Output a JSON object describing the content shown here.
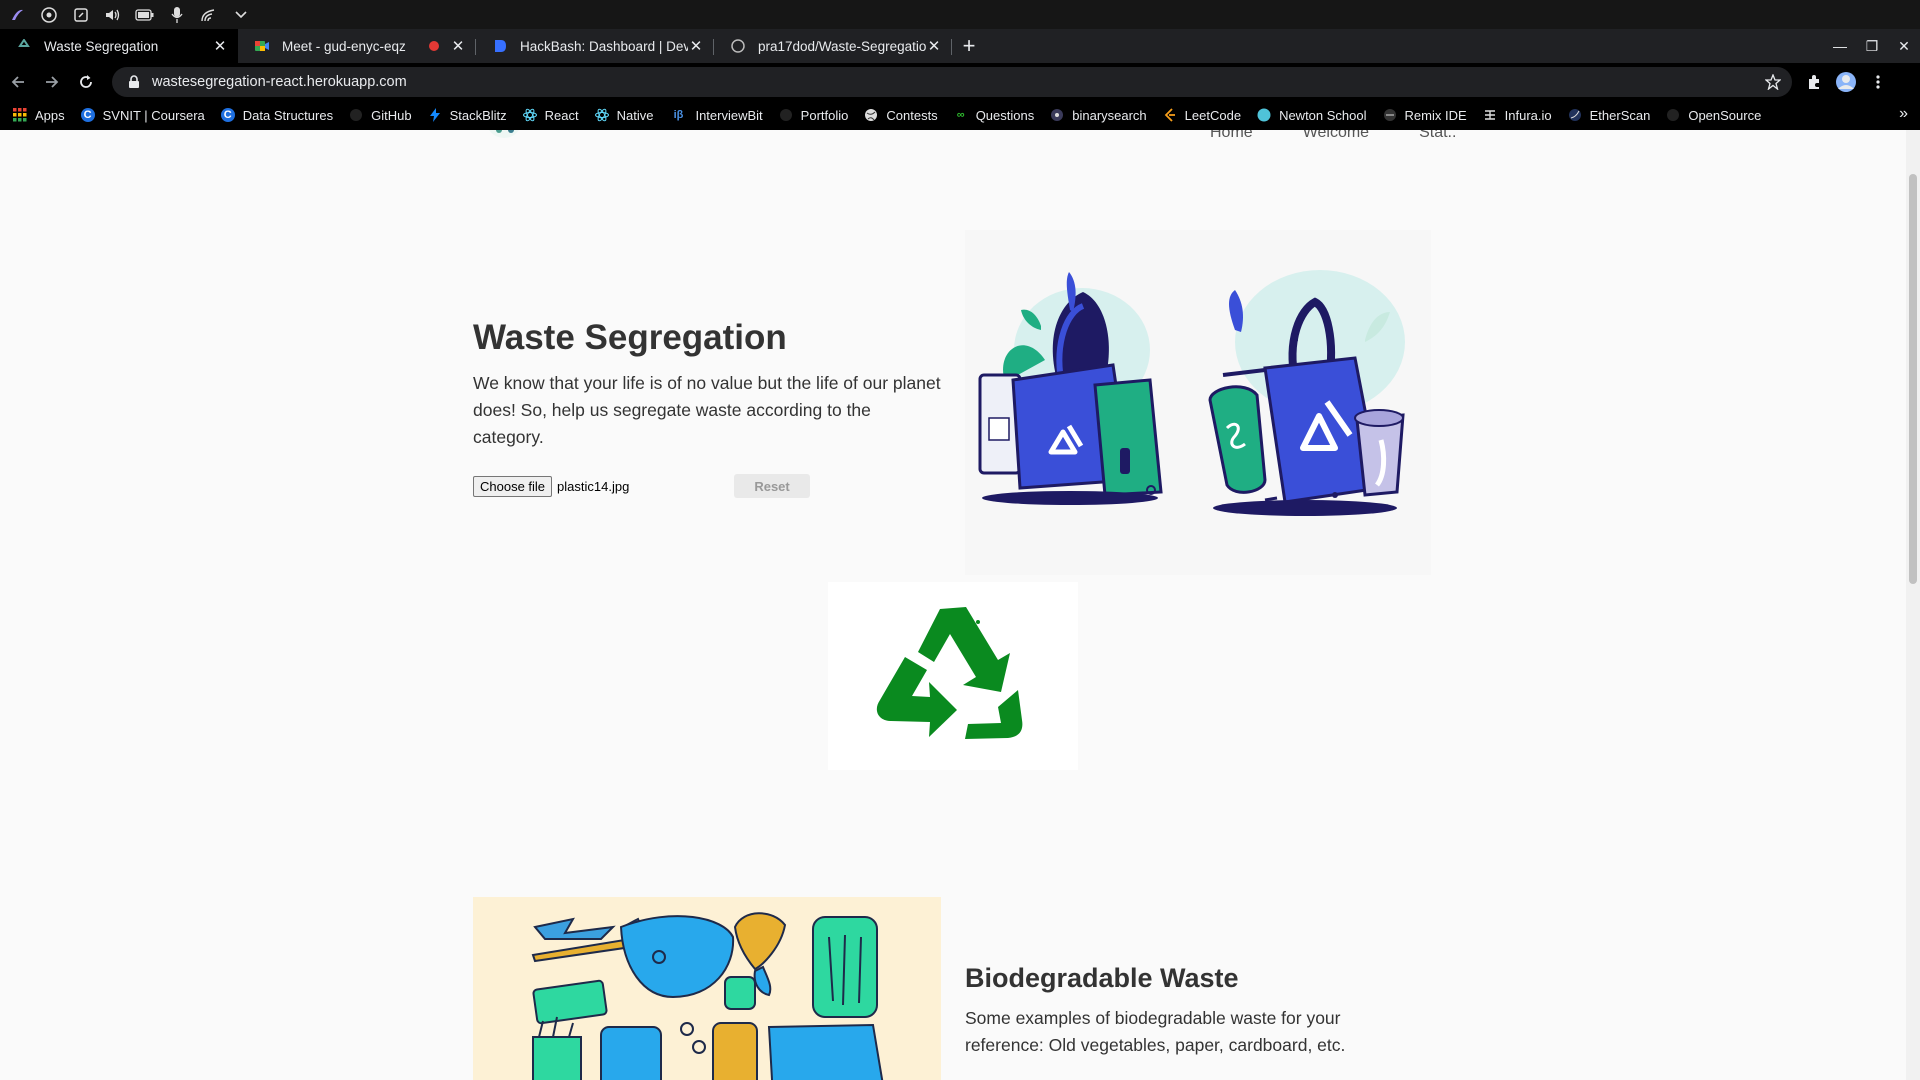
{
  "browser": {
    "tabs": [
      {
        "title": "Waste Segregation",
        "active": true
      },
      {
        "title": "Meet - gud-enyc-eqz",
        "active": false
      },
      {
        "title": "HackBash: Dashboard | Devfolio",
        "active": false
      },
      {
        "title": "pra17dod/Waste-Segregation",
        "active": false
      }
    ],
    "url": "wastesegregation-react.herokuapp.com",
    "bookmarks": [
      "Apps",
      "SVNIT | Coursera",
      "Data Structures",
      "GitHub",
      "StackBlitz",
      "React",
      "Native",
      "InterviewBit",
      "Portfolio",
      "Contests",
      "Questions",
      "binarysearch",
      "LeetCode",
      "Newton School",
      "Remix IDE",
      "Infura.io",
      "EtherScan",
      "OpenSource"
    ],
    "more_glyph": "»"
  },
  "site": {
    "nav": [
      "Home",
      "Welcome",
      "Stat.."
    ],
    "hero": {
      "title": "Waste Segregation",
      "description": "We know that your life is of no value but the life of our planet does! So, help us segregate waste according to the category.",
      "choose_file_label": "Choose file",
      "file_name": "plastic14.jpg",
      "reset_label": "Reset"
    },
    "bio": {
      "title": "Biodegradable Waste",
      "description": "Some examples of biodegradable waste for your reference: Old vegetables, paper, cardboard, etc."
    }
  },
  "colors": {
    "recycle_green": "#0a8a1f",
    "illus_blue": "#3a4fd8",
    "illus_navy": "#1e1a63",
    "illus_teal": "#1fae83",
    "bio_bg": "#fdf1d5"
  }
}
